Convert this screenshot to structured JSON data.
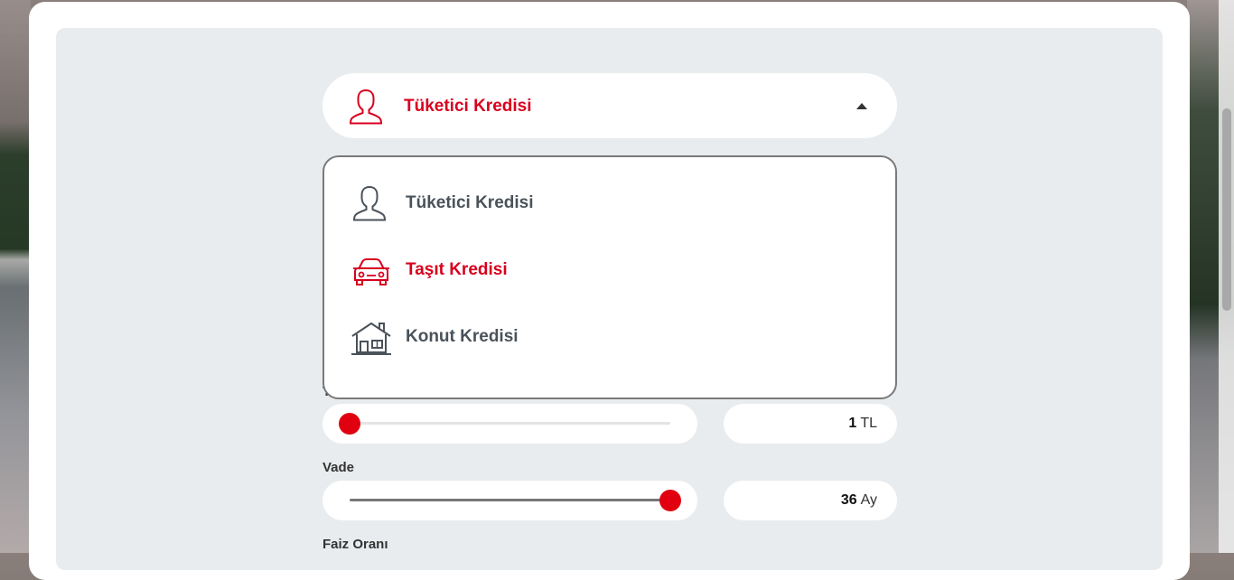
{
  "loan_selector": {
    "selected_label": "Tüketici Kredisi",
    "options": [
      {
        "label": "Tüketici Kredisi",
        "icon": "person-icon"
      },
      {
        "label": "Taşıt Kredisi",
        "icon": "car-icon",
        "highlighted": true
      },
      {
        "label": "Konut Kredisi",
        "icon": "house-icon"
      }
    ]
  },
  "amount": {
    "label_peek": "T",
    "value": "1",
    "unit": "TL",
    "slider_fraction": 0.0
  },
  "term": {
    "label": "Vade",
    "value": "36",
    "unit": "Ay",
    "slider_fraction": 1.0
  },
  "interest": {
    "label": "Faiz Oranı"
  },
  "colors": {
    "accent": "#e1000f",
    "panel_bg": "#e8ecee",
    "text_dark": "#4a525a"
  }
}
